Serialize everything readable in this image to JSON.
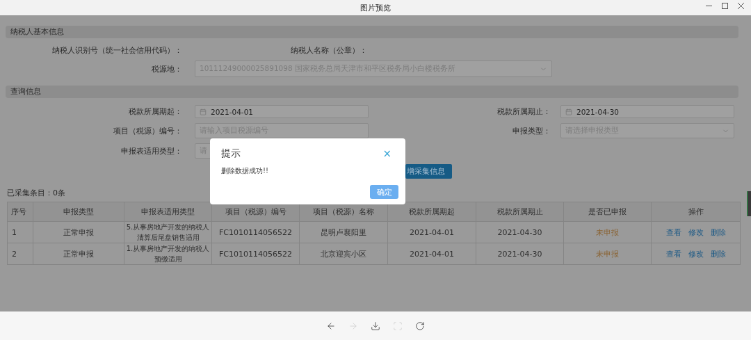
{
  "window": {
    "title": "图片预览"
  },
  "basic_info": {
    "title": "纳税人基本信息",
    "taxpayer_id_label": "纳税人识别号（统一社会信用代码）：",
    "taxpayer_name_label": "纳税人名称（公章）：",
    "tax_source_label": "税源地：",
    "tax_source_value": "10111249000025891098 国家税务总局天津市和平区税务局小白楼税务所"
  },
  "query": {
    "title": "查询信息",
    "fields": [
      {
        "label": "税款所属期起：",
        "kind": "date",
        "value": "2021-04-01"
      },
      {
        "label": "税款所属期止：",
        "kind": "date",
        "value": "2021-04-30"
      },
      {
        "label": "项目（税源）编号：",
        "kind": "text",
        "placeholder": "请输入项目税源编号"
      },
      {
        "label": "申报类型：",
        "kind": "select",
        "placeholder": "请选择申报类型"
      },
      {
        "label": "申报表适用类型：",
        "kind": "select",
        "placeholder": "请"
      }
    ],
    "add_button": "增采集信息"
  },
  "count_label": "已采集条目：0条",
  "table": {
    "columns": [
      "序号",
      "申报类型",
      "申报表适用类型",
      "项目（税源）编号",
      "项目（税源）名称",
      "税款所属期起",
      "税款所属期止",
      "是否已申报",
      "操作"
    ],
    "rows": [
      {
        "cells": [
          "1",
          "正常申报",
          "5.从事房地产开发的纳税人清算后尾盘销售适用",
          "FC1010114056522",
          "昆明卢襄阳里",
          "2021-04-01",
          "2021-04-30"
        ],
        "status": "未申报",
        "actions": [
          "查看",
          "修改",
          "删除"
        ]
      },
      {
        "cells": [
          "2",
          "正常申报",
          "1.从事房地产开发的纳税人预缴适用",
          "FC1010114056522",
          "北京迎宾小区",
          "2021-04-01",
          "2021-04-30"
        ],
        "status": "未申报",
        "actions": [
          "查看",
          "修改",
          "删除"
        ]
      }
    ]
  },
  "dialog": {
    "title": "提示",
    "close": "×",
    "message": "删除数据成功!!",
    "confirm": "确定"
  },
  "viewer_toolbar": [
    {
      "kind": "previous",
      "disabled": false
    },
    {
      "kind": "next",
      "disabled": true
    },
    {
      "kind": "download",
      "disabled": false
    },
    {
      "kind": "fit",
      "disabled": true
    },
    {
      "kind": "rotate",
      "disabled": false
    }
  ]
}
